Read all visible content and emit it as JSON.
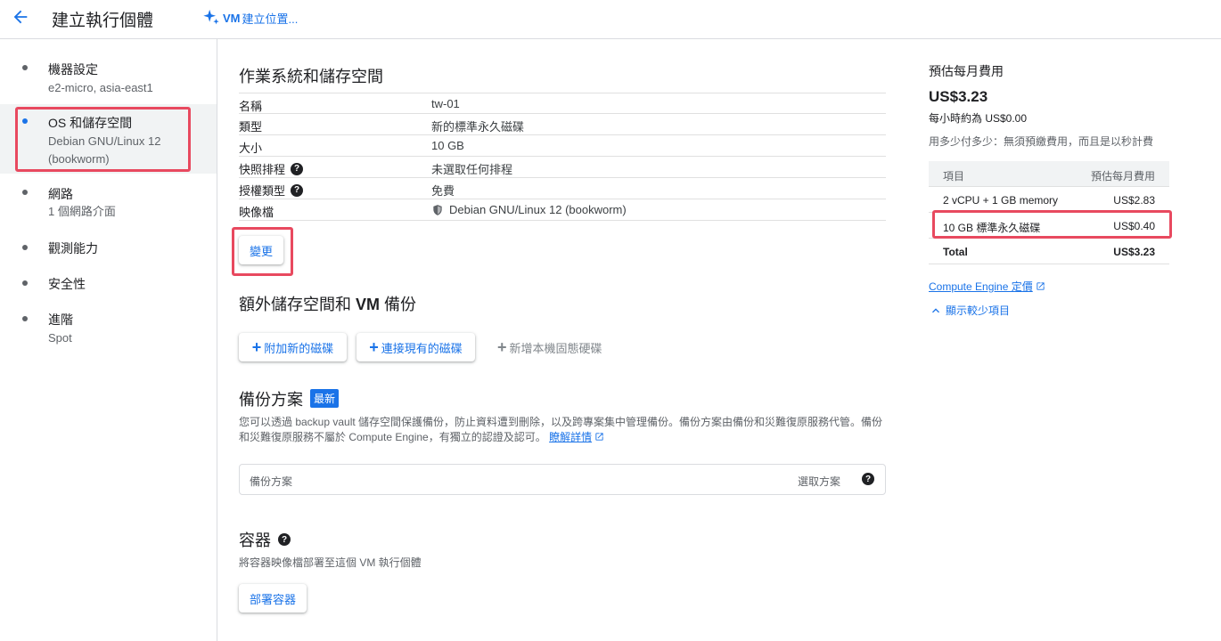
{
  "header": {
    "title": "建立執行個體",
    "vm_link": {
      "bold": "VM",
      "label": "建立位置..."
    }
  },
  "nav": [
    {
      "label": "機器設定",
      "sub": [
        "e2-micro, asia-east1"
      ]
    },
    {
      "label": "OS 和儲存空間",
      "sub": [
        "Debian GNU/Linux 12",
        "(bookworm)"
      ]
    },
    {
      "label": "網路",
      "sub": [
        "1 個網路介面"
      ]
    },
    {
      "label": "觀測能力",
      "sub": []
    },
    {
      "label": "安全性",
      "sub": []
    },
    {
      "label": "進階",
      "sub": [
        "Spot"
      ]
    }
  ],
  "os_storage": {
    "title": "作業系統和儲存空間",
    "rows": [
      {
        "key": "名稱",
        "value": "tw-01"
      },
      {
        "key": "類型",
        "value": "新的標準永久磁碟"
      },
      {
        "key": "大小",
        "value": "10 GB"
      },
      {
        "key": "快照排程",
        "value": "未選取任何排程"
      },
      {
        "key": "授權類型",
        "value": "免費"
      },
      {
        "key": "映像檔",
        "value": "Debian GNU/Linux 12 (bookworm)"
      }
    ],
    "change_label": "變更"
  },
  "extra_storage": {
    "title_pre": "額外儲存空間和 ",
    "title_bold": "VM",
    "title_post": " 備份",
    "add_disk": "附加新的磁碟",
    "attach_disk": "連接現有的磁碟",
    "add_local_ssd": "新增本機固態硬碟"
  },
  "backup": {
    "title": "備份方案",
    "badge": "最新",
    "desc": "您可以透過 backup vault 儲存空間保護備份，防止資料遭到刪除，以及跨專案集中管理備份。備份方案由備份和災難復原服務代管。備份和災難復原服務不屬於 Compute Engine，有獨立的認證及認可。",
    "learn_more": "瞭解詳情",
    "placeholder": "備份方案",
    "choose": "選取方案"
  },
  "container": {
    "title": "容器",
    "desc": "將容器映像檔部署至這個 VM 執行個體",
    "deploy": "部署容器"
  },
  "pricing": {
    "title": "預估每月費用",
    "total": "US$3.23",
    "hourly": "每小時約為 US$0.00",
    "note": "用多少付多少：無須預繳費用，而且是以秒計費",
    "table_head": [
      "項目",
      "預估每月費用"
    ],
    "rows": [
      {
        "item": "2 vCPU + 1 GB memory",
        "cost": "US$2.83"
      },
      {
        "item": "10 GB 標準永久磁碟",
        "cost": "US$0.40"
      },
      {
        "item": "Total",
        "cost": "US$3.23"
      }
    ],
    "pricing_link": "Compute Engine 定價",
    "show_less": "顯示較少項目"
  },
  "colors": {
    "accent": "#1a73e8",
    "highlight": "#e8495f"
  }
}
